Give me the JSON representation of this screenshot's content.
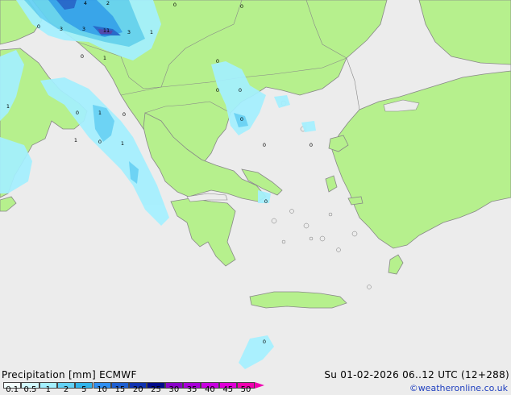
{
  "map": {
    "sea_color": "#ececec",
    "land_color": "#b6f08d",
    "border_color": "#888888",
    "precip_colors": [
      "#a4f0ff",
      "#63d1f5",
      "#2f9ff1",
      "#1e5fd0",
      "#4a3ab0"
    ],
    "values": [
      {
        "label": "4"
      },
      {
        "label": "2"
      },
      {
        "label": "0"
      },
      {
        "label": "0"
      },
      {
        "label": "0"
      },
      {
        "label": "3"
      },
      {
        "label": "3"
      },
      {
        "label": "11"
      },
      {
        "label": "3"
      },
      {
        "label": "1"
      },
      {
        "label": "0"
      },
      {
        "label": "1"
      },
      {
        "label": "0"
      },
      {
        "label": "0"
      },
      {
        "label": "0"
      },
      {
        "label": "1"
      },
      {
        "label": "0"
      },
      {
        "label": "1"
      },
      {
        "label": "0"
      },
      {
        "label": "0"
      },
      {
        "label": "1"
      },
      {
        "label": "0"
      },
      {
        "label": "1"
      },
      {
        "label": "0"
      },
      {
        "label": "0"
      },
      {
        "label": "0"
      }
    ]
  },
  "footer": {
    "title_left": "Precipitation [mm] ECMWF",
    "title_right": "Su 01-02-2026 06..12 UTC (12+288)",
    "credit": "©weatheronline.co.uk",
    "legend": {
      "ticks": [
        "0.1",
        "0.5",
        "1",
        "2",
        "5",
        "10",
        "15",
        "20",
        "25",
        "30",
        "35",
        "40",
        "45",
        "50"
      ],
      "colors": [
        "#f2fffe",
        "#d2fbff",
        "#a4f0ff",
        "#63d1f5",
        "#32b4ea",
        "#2f8ff1",
        "#1e5fd0",
        "#1033b0",
        "#000a8a",
        "#8a00c8",
        "#a800d8",
        "#c800e0",
        "#e000d8",
        "#f000b0"
      ]
    }
  }
}
